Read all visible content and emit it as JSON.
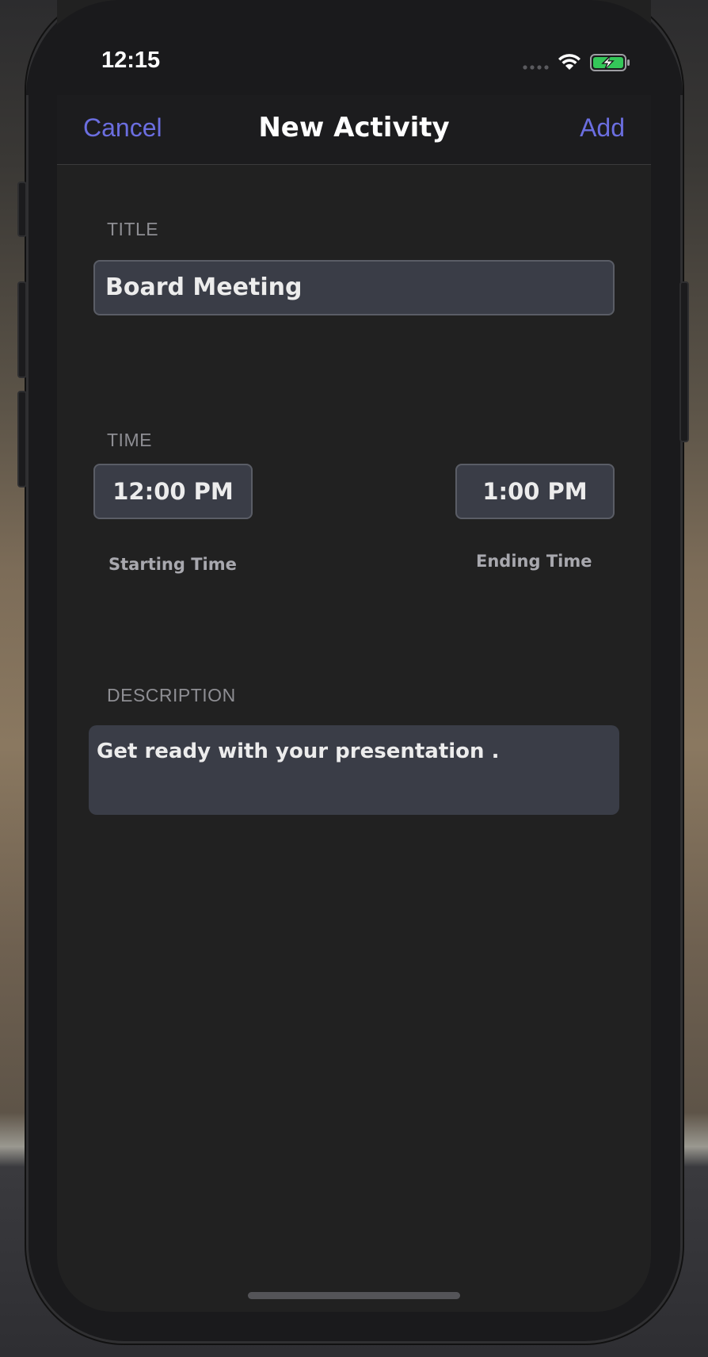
{
  "status_bar": {
    "time": "12:15",
    "icons": [
      "signal-dots-icon",
      "wifi-icon",
      "battery-charging-icon"
    ]
  },
  "navbar": {
    "cancel_label": "Cancel",
    "title": "New Activity",
    "add_label": "Add"
  },
  "form": {
    "title_section": {
      "label": "TITLE",
      "value": "Board Meeting"
    },
    "time_section": {
      "label": "TIME",
      "start": {
        "value": "12:00 PM",
        "caption": "Starting Time"
      },
      "end": {
        "value": "1:00 PM",
        "caption": "Ending Time"
      }
    },
    "description_section": {
      "label": "DESCRIPTION",
      "value": "Get ready with your presentation ."
    }
  },
  "colors": {
    "accent": "#6b6ee0",
    "background": "#212121",
    "field_background": "#3a3d47",
    "battery_green": "#34c759"
  }
}
